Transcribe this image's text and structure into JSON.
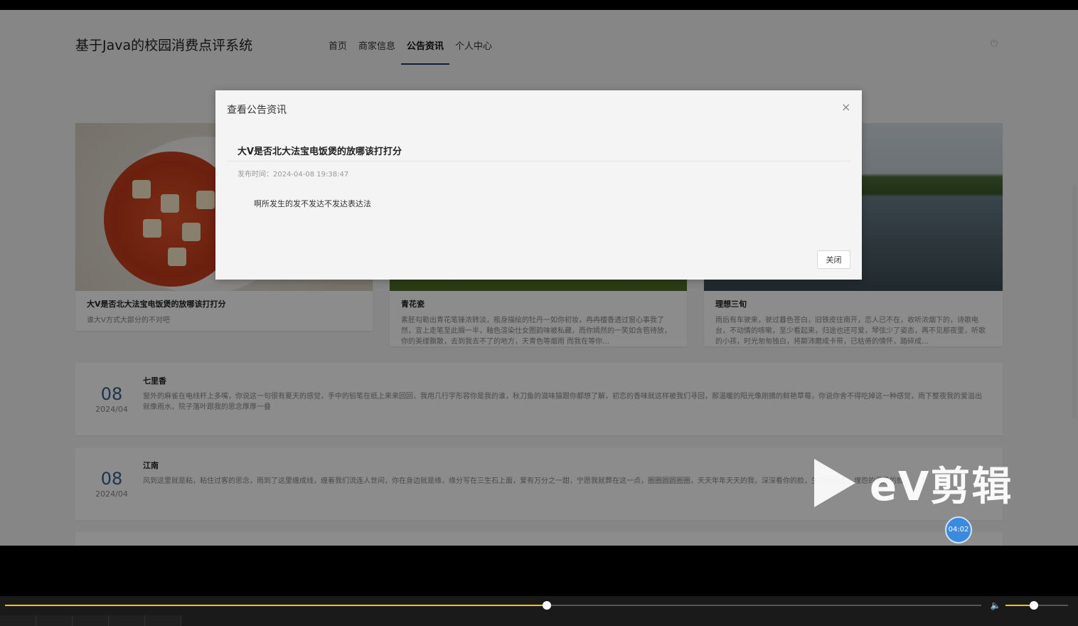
{
  "site": {
    "title": "基于Java的校园消费点评系统",
    "nav": [
      {
        "label": "首页",
        "active": false
      },
      {
        "label": "商家信息",
        "active": false
      },
      {
        "label": "公告资讯",
        "active": true
      },
      {
        "label": "个人中心",
        "active": false
      }
    ]
  },
  "cards": [
    {
      "title": "大V是否北大法宝电饭煲的放哪该打打分",
      "desc": "谁大V方式大部分的不对吧"
    },
    {
      "title": "青花瓷",
      "desc": "素胚勾勒出青花笔锋浓转淡，瓶身描绘的牡丹一如你初妆，冉冉檀香透过窗心事我了然，宣上走笔至此搁一半，釉色渲染仕女图韵味被私藏，而你嫣然的一笑如含苞待放，你的美缕飘散，去到我去不了的地方，天青色等烟雨 而我在等你…"
    },
    {
      "title": "理想三旬",
      "desc": "雨后有车驶来，驶过暮色苍白，旧铁皮往南开，恋人已不在，收听浓烟下的，诗歌电台，不动情的咳嗽，至少看起来，归途也还可爱，琴弦少了姿态，再不见那夜里，听歌的小孩，时光匆匆独白，将颠沛磨成卡带，已枯倦的情怀，踏碎成…"
    }
  ],
  "news": [
    {
      "day": "08",
      "ym": "2024/04",
      "title": "七里香",
      "text": "窗外的麻雀在电线杆上多嘴，你说这一句很有夏天的感觉，手中的铅笔在纸上来来回回，我用几行字形容你是我的谁，秋刀鱼的滋味猫跟你都想了解，初恋的香味就这样被我们寻回，那温暖的阳光像刚摘的鲜艳草莓，你说你舍不得吃掉这一种感觉，雨下整夜我的爱溢出就像雨水，院子落叶跟我的思念厚厚一叠"
    },
    {
      "day": "08",
      "ym": "2024/04",
      "title": "江南",
      "text": "风到这里就是粘，粘住过客的思念，雨到了这里缠成线，缠着我们流连人世间，你在身边就是缘，缘分写在三生石上面，爱有万分之一甜，宁愿我就葬在这一点，圈圈圆圆圈圈，天天年年天天的我，深深看你的脸，生气的温柔，埋怨的温柔的脸"
    }
  ],
  "modal": {
    "title": "查看公告资讯",
    "heading": "大V是否北大法宝电饭煲的放哪该打打分",
    "time": "发布时间：2024-04-08 19:38:47",
    "body": "啊所发生的发不发达不发达表达法",
    "close_label": "关闭",
    "close_icon": "×"
  },
  "watermark": {
    "text": "eV剪辑",
    "timer": "04:02"
  },
  "player": {
    "progress": 0.5552,
    "volume": 0.45
  }
}
